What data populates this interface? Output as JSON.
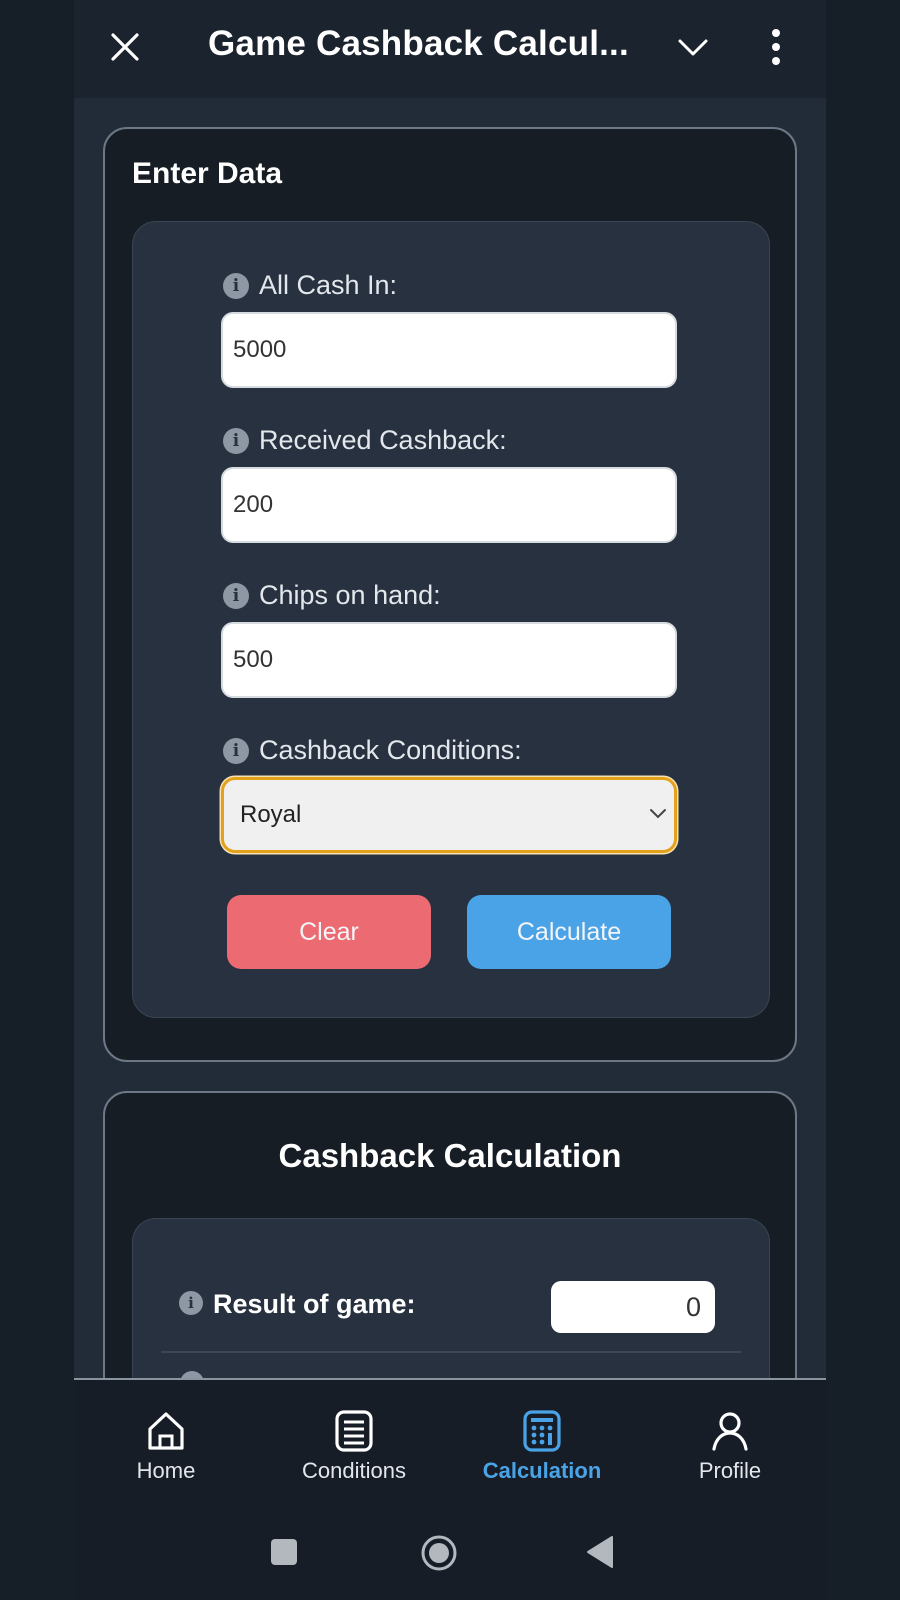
{
  "topbar": {
    "title": "Game Cashback Calcul...",
    "close_icon": "close-icon",
    "chevron_icon": "chevron-down-icon",
    "more_icon": "more-vertical-icon"
  },
  "enter_data": {
    "heading": "Enter Data",
    "fields": [
      {
        "label": "All Cash In:",
        "value": "5000"
      },
      {
        "label": "Received Cashback:",
        "value": "200"
      },
      {
        "label": "Chips on hand:",
        "value": "500"
      }
    ],
    "conditions": {
      "label": "Cashback Conditions:",
      "selected": "Royal"
    },
    "clear_label": "Clear",
    "calculate_label": "Calculate"
  },
  "calculation": {
    "heading": "Cashback Calculation",
    "rows": [
      {
        "label": "Result of game:",
        "value": "0"
      }
    ]
  },
  "bottom_nav": {
    "items": [
      {
        "label": "Home",
        "icon": "home-icon",
        "active": false
      },
      {
        "label": "Conditions",
        "icon": "list-icon",
        "active": false
      },
      {
        "label": "Calculation",
        "icon": "calculator-icon",
        "active": true
      },
      {
        "label": "Profile",
        "icon": "profile-icon",
        "active": false
      }
    ]
  },
  "colors": {
    "accent": "#4aa3e6",
    "danger": "#ec6a71",
    "focus": "#e4a11b",
    "background": "#222c39"
  }
}
